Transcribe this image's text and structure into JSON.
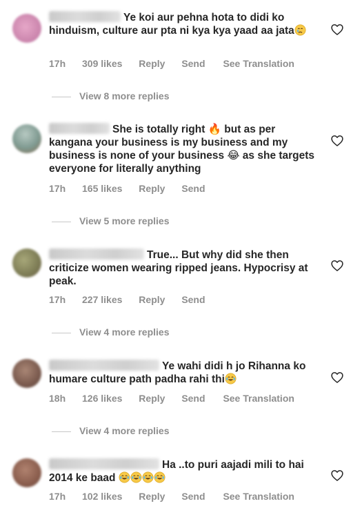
{
  "comments": [
    {
      "text": "Ye koi aur pehna hota to didi ko hinduism, culture aur pta ni kya kya yaad aa jata",
      "emoji": "crying-face",
      "time": "17h",
      "likes": "309 likes",
      "reply": "Reply",
      "send": "Send",
      "translation": "See Translation",
      "replies": "View 8 more replies",
      "avatar_color": "#d58fb3"
    },
    {
      "text": "She is totally right 🔥 but as per kangana your business is my business and my business is none of your business 😂 as she targets everyone for literally anything",
      "time": "17h",
      "likes": "165 likes",
      "reply": "Reply",
      "send": "Send",
      "replies": "View 5 more replies",
      "avatar_color": "#8aa5a0"
    },
    {
      "text": "True... But why did she then criticize women wearing ripped jeans. Hypocrisy at peak.",
      "time": "17h",
      "likes": "227 likes",
      "reply": "Reply",
      "send": "Send",
      "replies": "View 4 more replies",
      "avatar_color": "#8a8a5c"
    },
    {
      "text": "Ye wahi didi h jo Rihanna ko humare culture path padha rahi thi",
      "emoji": "joy-face",
      "time": "18h",
      "likes": "126 likes",
      "reply": "Reply",
      "send": "Send",
      "translation": "See Translation",
      "replies": "View 4 more replies",
      "avatar_color": "#7d5d52"
    },
    {
      "text": "Ha ..to puri aajadi mili to hai 2014 ke baad",
      "emoji": "joy-face",
      "time": "17h",
      "likes": "102 likes",
      "reply": "Reply",
      "send": "Send",
      "translation": "See Translation",
      "avatar_color": "#8c5f4f"
    }
  ],
  "colors": {
    "text": "#262626",
    "meta": "#8e8e8e",
    "divider": "#c7c7c7"
  }
}
